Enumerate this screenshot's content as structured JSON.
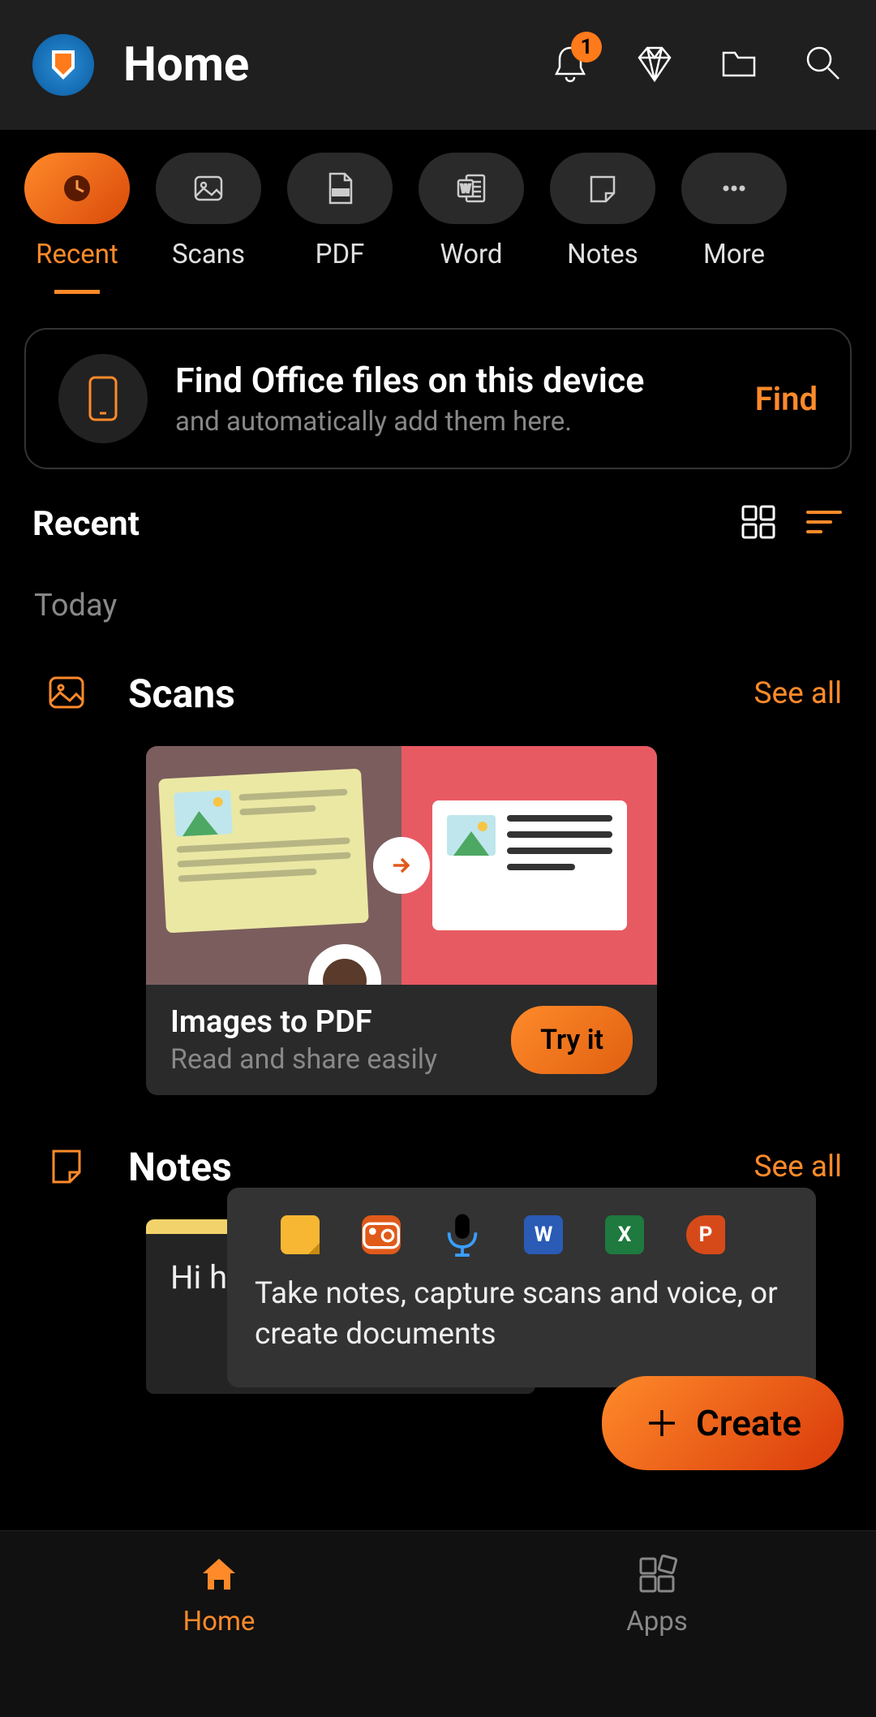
{
  "header": {
    "title": "Home",
    "notification_badge": "1"
  },
  "filter_tabs": [
    {
      "label": "Recent",
      "icon": "clock",
      "active": true
    },
    {
      "label": "Scans",
      "icon": "image"
    },
    {
      "label": "PDF",
      "icon": "pdf"
    },
    {
      "label": "Word",
      "icon": "word"
    },
    {
      "label": "Notes",
      "icon": "note"
    },
    {
      "label": "More",
      "icon": "more"
    }
  ],
  "banner": {
    "title": "Find Office files on this device",
    "subtitle": "and automatically add them here.",
    "action": "Find"
  },
  "section_bar": {
    "title": "Recent"
  },
  "date_group": "Today",
  "scans_section": {
    "title": "Scans",
    "see_all": "See all",
    "card": {
      "title": "Images to PDF",
      "subtitle": "Read and share easily",
      "action": "Try it"
    }
  },
  "notes_section": {
    "title": "Notes",
    "see_all": "See all",
    "card": {
      "preview_text": "Hi h"
    }
  },
  "tooltip": {
    "text": "Take notes, capture scans and voice, or create documents",
    "icons": [
      "note",
      "camera",
      "mic",
      "word",
      "excel",
      "powerpoint"
    ]
  },
  "fab": {
    "label": "Create"
  },
  "bottom_nav": {
    "items": [
      {
        "label": "Home",
        "icon": "home",
        "active": true
      },
      {
        "label": "Apps",
        "icon": "apps",
        "active": false
      }
    ]
  },
  "colors": {
    "accent": "#ff8a2a"
  }
}
